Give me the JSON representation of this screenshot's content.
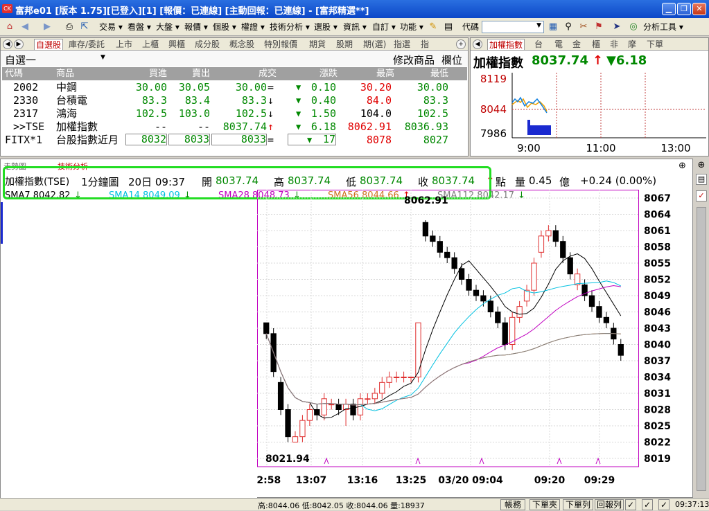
{
  "window": {
    "app_icon": "CK",
    "title": "富邦e01 [版本 1.75][已登入][1] [報價：已連線] [主動回報：已連線] - [富邦精選**]",
    "buttons": [
      "minimize-icon",
      "restore-icon",
      "close-icon"
    ]
  },
  "toolbar": {
    "menus": [
      "交易",
      "看盤",
      "大盤",
      "報價",
      "個股",
      "權證",
      "技術分析",
      "選股",
      "資訊",
      "自訂",
      "功能"
    ],
    "code_label": "代碼",
    "tools_label": "分析工具"
  },
  "watchlist": {
    "tabs": [
      "自選股",
      "庫存/委託",
      "上市",
      "上櫃",
      "興櫃",
      "成分股",
      "概念股",
      "特別報價",
      "期貨",
      "股期",
      "期(選)",
      "指選",
      "指"
    ],
    "group": "自選一",
    "modify_label": "修改商品",
    "column_label": "欄位",
    "headers": [
      "代碼",
      "商品",
      "買進",
      "賣出",
      "成交",
      "漲跌",
      "最高",
      "最低"
    ],
    "rows": [
      {
        "code": "2002",
        "name": "中鋼",
        "bid": "30.00",
        "ask": "30.05",
        "last": "30.00",
        "last_mark": "=",
        "chg": "0.10",
        "high": "30.20",
        "low": "30.00"
      },
      {
        "code": "2330",
        "name": "台積電",
        "bid": "83.3",
        "ask": "83.4",
        "last": "83.3",
        "last_mark": "↓",
        "chg": "0.40",
        "high": "84.0",
        "low": "83.3"
      },
      {
        "code": "2317",
        "name": "鴻海",
        "bid": "102.5",
        "ask": "103.0",
        "last": "102.5",
        "last_mark": "↓",
        "chg": "1.50",
        "high": "104.0",
        "low": "102.5"
      },
      {
        "code": ">>TSE",
        "name": "加權指數",
        "bid": "--",
        "ask": "--",
        "last": "8037.74",
        "last_mark": "↑",
        "chg": "6.18",
        "high": "8062.91",
        "low": "8036.93"
      },
      {
        "code": "FITX*1",
        "name": "台股指數近月",
        "bid": "8032",
        "ask": "8033",
        "last": "8033",
        "last_mark": "=",
        "chg": "17",
        "high": "8078",
        "low": "8027"
      }
    ]
  },
  "mini_chart": {
    "tabs": [
      "加權指數",
      "台",
      "電",
      "金",
      "櫃",
      "非",
      "摩",
      "下單"
    ],
    "name": "加權指數",
    "price": "8037.74",
    "price_mark": "↑",
    "change": "▼6.18",
    "y_ticks": [
      "8119",
      "8044",
      "7986"
    ],
    "x_ticks": [
      "9:00",
      "11:00",
      "13:00"
    ]
  },
  "main_chart": {
    "tabs": [
      "走勢圖",
      "技術分析"
    ],
    "info": {
      "name": "加權指數(TSE)",
      "period": "1分鐘圖",
      "datetime": "20日 09:37",
      "open_label": "開",
      "open": "8037.74",
      "high_label": "高",
      "high": "8037.74",
      "low_label": "低",
      "low": "8037.74",
      "close_label": "收",
      "close": "8037.74",
      "close_mark": "↑",
      "unit": "點",
      "vol_label": "量",
      "vol": "0.45",
      "vol_unit": "億",
      "change": "+0.24 (0.00%)"
    },
    "ma_labels": [
      {
        "text": "SMA7 8042.82",
        "color": "#000000"
      },
      {
        "text": "SMA14 8049.09",
        "color": "#00c0e0"
      },
      {
        "text": "SMA28 8048.73",
        "color": "#c000c0"
      },
      {
        "text": "SMA56 8044.66",
        "color": "#d07020"
      },
      {
        "text": "SMA112 8042.17",
        "color": "#808080"
      }
    ],
    "y_ticks": [
      "8067",
      "8064",
      "8061",
      "8058",
      "8055",
      "8052",
      "8049",
      "8046",
      "8043",
      "8040",
      "8037",
      "8034",
      "8031",
      "8028",
      "8025",
      "8022",
      "8019"
    ],
    "x_ticks": [
      ":2:58",
      "13:07",
      "13:16",
      "13:25",
      "03/20 09:04",
      "09:20",
      "09:29"
    ],
    "annot_high": "8062.91",
    "annot_low": "8021.94"
  },
  "chart_data": {
    "type": "candlestick",
    "title": "加權指數(TSE) 1分鐘圖",
    "ylim": [
      8019,
      8067
    ],
    "candles": [
      {
        "o": 8044,
        "c": 8042,
        "h": 8044,
        "l": 8041
      },
      {
        "o": 8042,
        "c": 8035,
        "h": 8043,
        "l": 8034
      },
      {
        "o": 8033,
        "c": 8028,
        "h": 8034,
        "l": 8027
      },
      {
        "o": 8028,
        "c": 8023,
        "h": 8029,
        "l": 8022
      },
      {
        "o": 8022,
        "c": 8023,
        "h": 8024,
        "l": 8021.94
      },
      {
        "o": 8023,
        "c": 8026,
        "h": 8027,
        "l": 8022
      },
      {
        "o": 8026,
        "c": 8028,
        "h": 8029,
        "l": 8025
      },
      {
        "o": 8028,
        "c": 8027,
        "h": 8029,
        "l": 8026
      },
      {
        "o": 8027,
        "c": 8030,
        "h": 8031,
        "l": 8026
      },
      {
        "o": 8029,
        "c": 8029,
        "h": 8030,
        "l": 8028
      },
      {
        "o": 8029,
        "c": 8028,
        "h": 8030,
        "l": 8027
      },
      {
        "o": 8028,
        "c": 8029,
        "h": 8030,
        "l": 8025
      },
      {
        "o": 8029,
        "c": 8027,
        "h": 8030,
        "l": 8026
      },
      {
        "o": 8027,
        "c": 8030,
        "h": 8031,
        "l": 8026
      },
      {
        "o": 8030,
        "c": 8030,
        "h": 8031,
        "l": 8029
      },
      {
        "o": 8030,
        "c": 8031,
        "h": 8032,
        "l": 8029
      },
      {
        "o": 8031,
        "c": 8033,
        "h": 8034,
        "l": 8030
      },
      {
        "o": 8033,
        "c": 8034,
        "h": 8035,
        "l": 8032
      },
      {
        "o": 8034,
        "c": 8034,
        "h": 8035,
        "l": 8033
      },
      {
        "o": 8034,
        "c": 8034,
        "h": 8035,
        "l": 8033
      },
      {
        "o": 8034,
        "c": 8034,
        "h": 8034,
        "l": 8033
      },
      {
        "o": 8034,
        "c": 8044,
        "h": 8044,
        "l": 8033
      },
      {
        "o": 8062.5,
        "c": 8060,
        "h": 8062.91,
        "l": 8059
      },
      {
        "o": 8060,
        "c": 8059,
        "h": 8061,
        "l": 8058
      },
      {
        "o": 8059,
        "c": 8057,
        "h": 8060,
        "l": 8056
      },
      {
        "o": 8057,
        "c": 8056,
        "h": 8058,
        "l": 8055
      },
      {
        "o": 8056,
        "c": 8054,
        "h": 8057,
        "l": 8053
      },
      {
        "o": 8054,
        "c": 8052,
        "h": 8055,
        "l": 8051
      },
      {
        "o": 8052,
        "c": 8050,
        "h": 8053,
        "l": 8049
      },
      {
        "o": 8050,
        "c": 8049,
        "h": 8051,
        "l": 8048
      },
      {
        "o": 8049,
        "c": 8048,
        "h": 8050,
        "l": 8047
      },
      {
        "o": 8048,
        "c": 8046,
        "h": 8049,
        "l": 8045
      },
      {
        "o": 8046,
        "c": 8044,
        "h": 8047,
        "l": 8043
      },
      {
        "o": 8044,
        "c": 8040,
        "h": 8045,
        "l": 8039
      },
      {
        "o": 8040,
        "c": 8045,
        "h": 8046,
        "l": 8039
      },
      {
        "o": 8045,
        "c": 8047,
        "h": 8048,
        "l": 8044
      },
      {
        "o": 8048,
        "c": 8050,
        "h": 8051,
        "l": 8047
      },
      {
        "o": 8050,
        "c": 8055,
        "h": 8056,
        "l": 8049
      },
      {
        "o": 8057,
        "c": 8060,
        "h": 8061,
        "l": 8056
      },
      {
        "o": 8060,
        "c": 8061,
        "h": 8062,
        "l": 8059
      },
      {
        "o": 8061,
        "c": 8059,
        "h": 8062,
        "l": 8058
      },
      {
        "o": 8059,
        "c": 8056,
        "h": 8060,
        "l": 8055
      },
      {
        "o": 8056,
        "c": 8053,
        "h": 8057,
        "l": 8052
      },
      {
        "o": 8051,
        "c": 8053,
        "h": 8054,
        "l": 8050
      },
      {
        "o": 8051,
        "c": 8049,
        "h": 8052,
        "l": 8048
      },
      {
        "o": 8049,
        "c": 8047,
        "h": 8050,
        "l": 8046
      },
      {
        "o": 8047,
        "c": 8045,
        "h": 8048,
        "l": 8044
      },
      {
        "o": 8045,
        "c": 8044,
        "h": 8046,
        "l": 8043
      },
      {
        "o": 8043,
        "c": 8041,
        "h": 8044,
        "l": 8040
      },
      {
        "o": 8040,
        "c": 8038,
        "h": 8041,
        "l": 8037
      }
    ]
  },
  "status": {
    "text": "高:8044.06 低:8042.05 收:8044.06 量:18937",
    "buttons": [
      "帳務",
      "下單夾",
      "下單列",
      "回報列"
    ],
    "time": "09:37:13"
  }
}
